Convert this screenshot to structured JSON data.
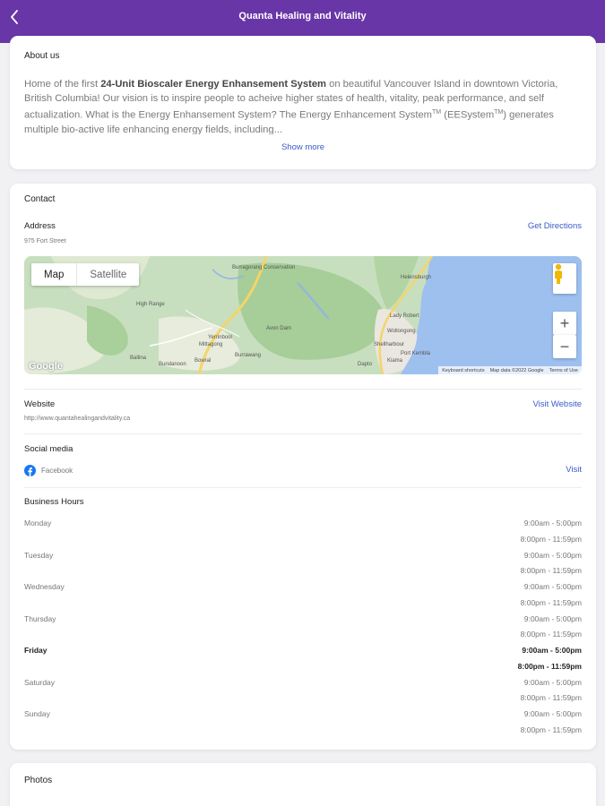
{
  "header": {
    "title": "Quanta Healing and Vitality",
    "back_icon": "chevron-left-icon"
  },
  "about": {
    "title": "About us",
    "text_parts": {
      "p1": "Home of the first ",
      "bold": "24-Unit Bioscaler Energy Enhansement System",
      "p2": " on beautiful Vancouver Island in downtown Victoria, British Columbia! Our vision is to inspire people to acheive higher states of health, vitality, peak performance, and self actualization. What is the Energy Enhansement System? The Energy Enhancement System",
      "tm1": "TM",
      "p3": " (EESystem",
      "tm2": "TM",
      "p4": ") generates multiple bio-active life enhancing energy fields, including..."
    },
    "show_more": "Show more"
  },
  "contact": {
    "title": "Contact",
    "address_label": "Address",
    "address": "975 Fort Street",
    "directions": "Get Directions",
    "map": {
      "map_option": "Map",
      "satellite_option": "Satellite",
      "zoom_in": "+",
      "zoom_out": "−",
      "logo": "Google",
      "attribution": [
        "Keyboard shortcuts",
        "Map data ©2022 Google",
        "Terms of Use"
      ],
      "place_labels": [
        "Burragorang Conservation",
        "High Range",
        "Yerrinbool",
        "Mittagong",
        "Bowral",
        "Burrawang",
        "Bundanoon",
        "Avon Dam",
        "Helensburgh",
        "Lady Robert",
        "Wollongong",
        "Shellharbour",
        "Port Kembla",
        "Dapto",
        "Kiama",
        "Ballina"
      ]
    },
    "website_label": "Website",
    "website_url": "http://www.quantahealingandvitality.ca",
    "visit_website": "Visit Website",
    "social_label": "Social media",
    "facebook_label": "Facebook",
    "visit": "Visit",
    "hours_label": "Business Hours",
    "hours": [
      {
        "day": "Monday",
        "slot1": "9:00am - 5:00pm",
        "slot2": "8:00pm - 11:59pm"
      },
      {
        "day": "Tuesday",
        "slot1": "9:00am - 5:00pm",
        "slot2": "8:00pm - 11:59pm"
      },
      {
        "day": "Wednesday",
        "slot1": "9:00am - 5:00pm",
        "slot2": "8:00pm - 11:59pm"
      },
      {
        "day": "Thursday",
        "slot1": "9:00am - 5:00pm",
        "slot2": "8:00pm - 11:59pm"
      },
      {
        "day": "Friday",
        "slot1": "9:00am - 5:00pm",
        "slot2": "8:00pm - 11:59pm"
      },
      {
        "day": "Saturday",
        "slot1": "9:00am - 5:00pm",
        "slot2": "8:00pm - 11:59pm"
      },
      {
        "day": "Sunday",
        "slot1": "9:00am - 5:00pm",
        "slot2": "8:00pm - 11:59pm"
      }
    ],
    "highlighted_day": "Friday"
  },
  "photos": {
    "title": "Photos"
  },
  "colors": {
    "header": "#6836a6",
    "link": "#3a5bc7",
    "water": "#9ec0ef",
    "land": "#c8dfbf"
  }
}
